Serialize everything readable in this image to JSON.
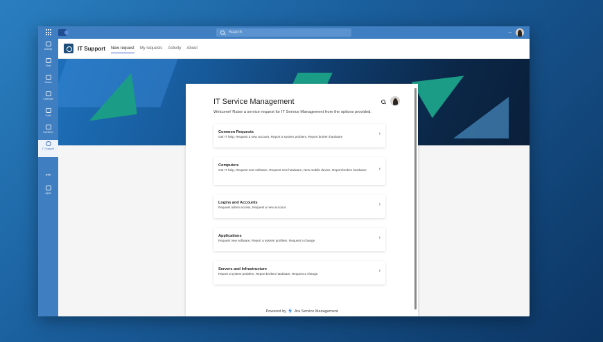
{
  "titlebar": {
    "search_placeholder": "Search",
    "minimize": "–"
  },
  "rail": {
    "items": [
      {
        "label": "Activity"
      },
      {
        "label": "Chat"
      },
      {
        "label": "Teams"
      },
      {
        "label": "Calendar"
      },
      {
        "label": "Calls"
      },
      {
        "label": "OneDrive"
      },
      {
        "label": "IT Support"
      },
      {
        "label": "Apps"
      }
    ],
    "more": "•••"
  },
  "appbar": {
    "title": "IT Support",
    "tabs": [
      "New request",
      "My requests",
      "Activity",
      "About"
    ],
    "active_tab": "New request"
  },
  "panel": {
    "title": "IT Service Management",
    "subtitle": "Welcome! Raise a service request for IT Service Management from the options provided.",
    "cards": [
      {
        "title": "Common Requests",
        "desc": "Get IT help, Request a new account, Report a system problem, Report broken hardware"
      },
      {
        "title": "Computers",
        "desc": "Get IT help, Request new software, Request new hardware, New mobile device, Report broken hardware"
      },
      {
        "title": "Logins and Accounts",
        "desc": "Request admin access, Request a new account"
      },
      {
        "title": "Applications",
        "desc": "Request new software, Report a system problem, Request a change"
      },
      {
        "title": "Servers and Infrastructure",
        "desc": "Report a system problem, Report broken hardware, Request a change"
      }
    ],
    "footer_prefix": "Powered by",
    "footer_brand": "Jira Service Management"
  },
  "colors": {
    "accent": "#3a5ec6",
    "rail": "#3f7ec0",
    "hero_green": "#1a9c86"
  }
}
